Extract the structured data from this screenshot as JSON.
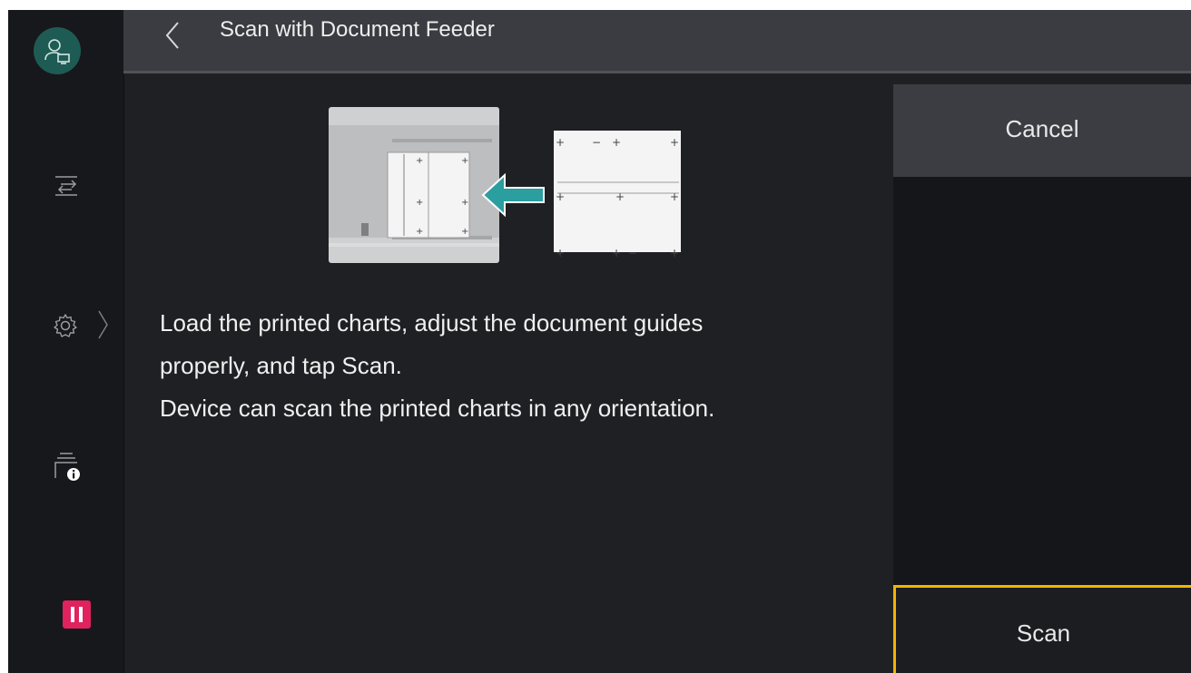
{
  "header": {
    "title": "Scan with Document Feeder"
  },
  "icons": {
    "user": "user-account-icon",
    "switch": "switch-arrows-icon",
    "settings": "gear-icon",
    "device_info": "printer-info-icon",
    "pause": "pause-icon",
    "back": "chevron-left-icon",
    "expand": "chevron-right-icon"
  },
  "colors": {
    "accent_teal": "#2b9ea0",
    "pause_red": "#e0225f",
    "focus_yellow": "#f2b400"
  },
  "main": {
    "instructions": [
      "Load the printed charts, adjust the document guides",
      "properly, and tap Scan.",
      "Device can scan the printed charts in any orientation."
    ]
  },
  "actions": {
    "cancel_label": "Cancel",
    "scan_label": "Scan"
  }
}
